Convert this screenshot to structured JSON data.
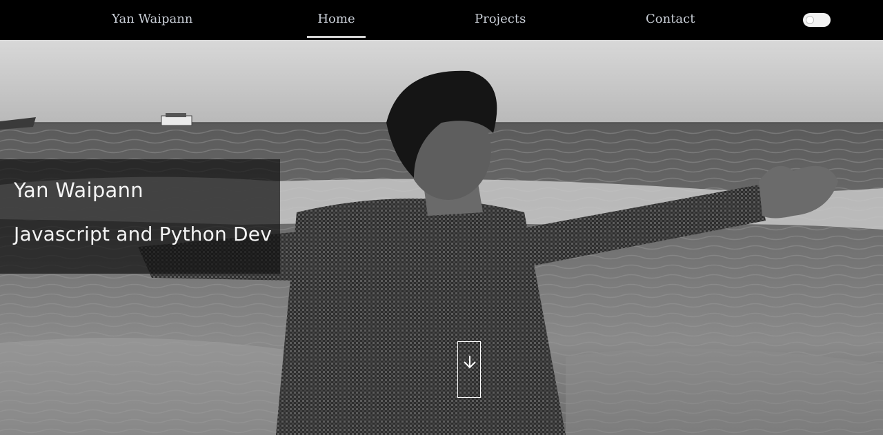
{
  "nav": {
    "brand": "Yan Waipann",
    "links": [
      {
        "label": "Home",
        "active": true
      },
      {
        "label": "Projects",
        "active": false
      },
      {
        "label": "Contact",
        "active": false
      }
    ],
    "theme_toggle": {
      "icon": "toggle-switch-icon",
      "state": "off"
    }
  },
  "hero": {
    "background": "black-and-white photo of a man at the beach with arms outstretched toward the sea",
    "name": "Yan Waipann",
    "role": "Javascript and Python Dev",
    "scroll_icon": "arrow-down-icon"
  },
  "colors": {
    "nav_bg": "#000000",
    "nav_text": "#c9ced6",
    "intro_box_bg": "rgba(20,20,20,0.72)",
    "hero_text": "#f4f4f4"
  }
}
